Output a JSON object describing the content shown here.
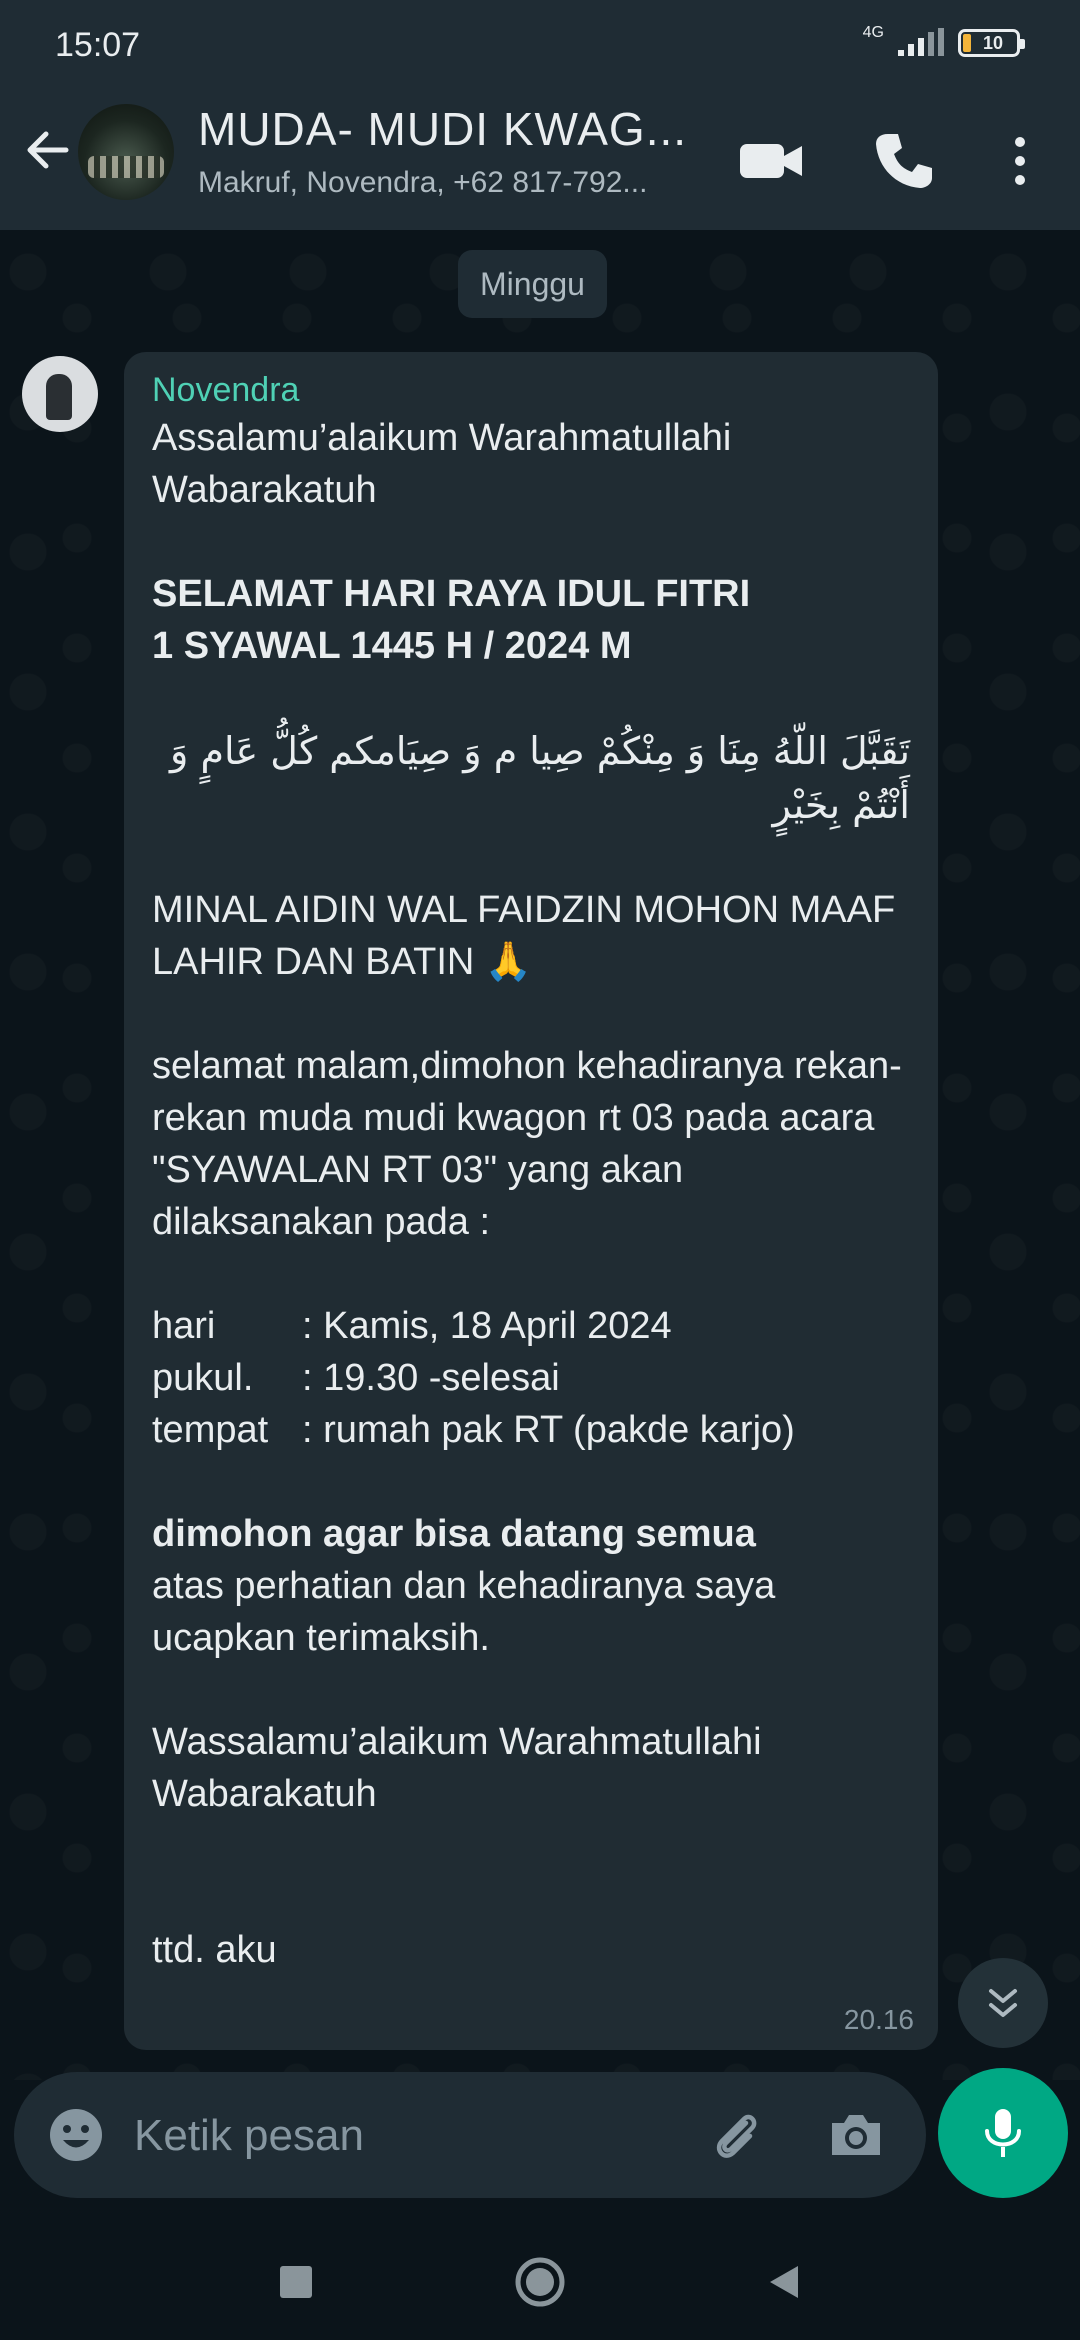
{
  "status_bar": {
    "time": "15:07",
    "network": "4G",
    "battery": "10"
  },
  "header": {
    "title": "MUDA- MUDI  KWAG...",
    "subtitle": "Makruf, Novendra, +62 817-792..."
  },
  "chat": {
    "date_chip": "Minggu",
    "message": {
      "sender": "Novendra",
      "greeting": "Assalamu’alaikum Warahmatullahi Wabarakatuh",
      "headline_1": "SELAMAT HARI RAYA IDUL FITRI",
      "headline_2": "1 SYAWAL 1445 H / 2024 M",
      "arabic": "تَقَبَّلَ اللّهُ مِنَا وَ مِنْكُمْ صِيا م وَ صِيَامكم كُلُّ عَامٍ وَ أَنْتُمْ بِخَيْرٍ",
      "minal": "MINAL AIDIN WAL FAIDZIN MOHON MAAF LAHIR DAN BATIN 🙏",
      "invitation": "selamat malam,dimohon kehadiranya rekan-rekan muda mudi kwagon rt 03 pada acara \"SYAWALAN RT 03\" yang akan dilaksanakan pada :",
      "schedule": [
        {
          "key": "hari",
          "value": ": Kamis, 18 April 2024"
        },
        {
          "key": "pukul.",
          "value": ": 19.30 -selesai"
        },
        {
          "key": "tempat",
          "value": ": rumah pak RT (pakde karjo)"
        }
      ],
      "request_bold": "dimohon agar bisa datang semua",
      "thanks": "atas perhatian dan kehadiranya saya ucapkan terimaksih.",
      "closing": "Wassalamu’alaikum Warahmatullahi Wabarakatuh",
      "signature": "ttd. aku",
      "time": "20.16"
    }
  },
  "composer": {
    "placeholder": "Ketik pesan"
  },
  "icons": {
    "back": "arrow-left-icon",
    "video": "video-camera-icon",
    "call": "phone-icon",
    "menu": "more-vertical-icon",
    "emoji": "emoji-icon",
    "attach": "paperclip-icon",
    "camera": "camera-icon",
    "mic": "microphone-icon",
    "scroll": "double-chevron-down-icon"
  },
  "colors": {
    "accent": "#00a884",
    "sender_name": "#4fd1b5",
    "bubble": "#202c33",
    "background": "#0b141a",
    "header": "#1f2c34"
  }
}
